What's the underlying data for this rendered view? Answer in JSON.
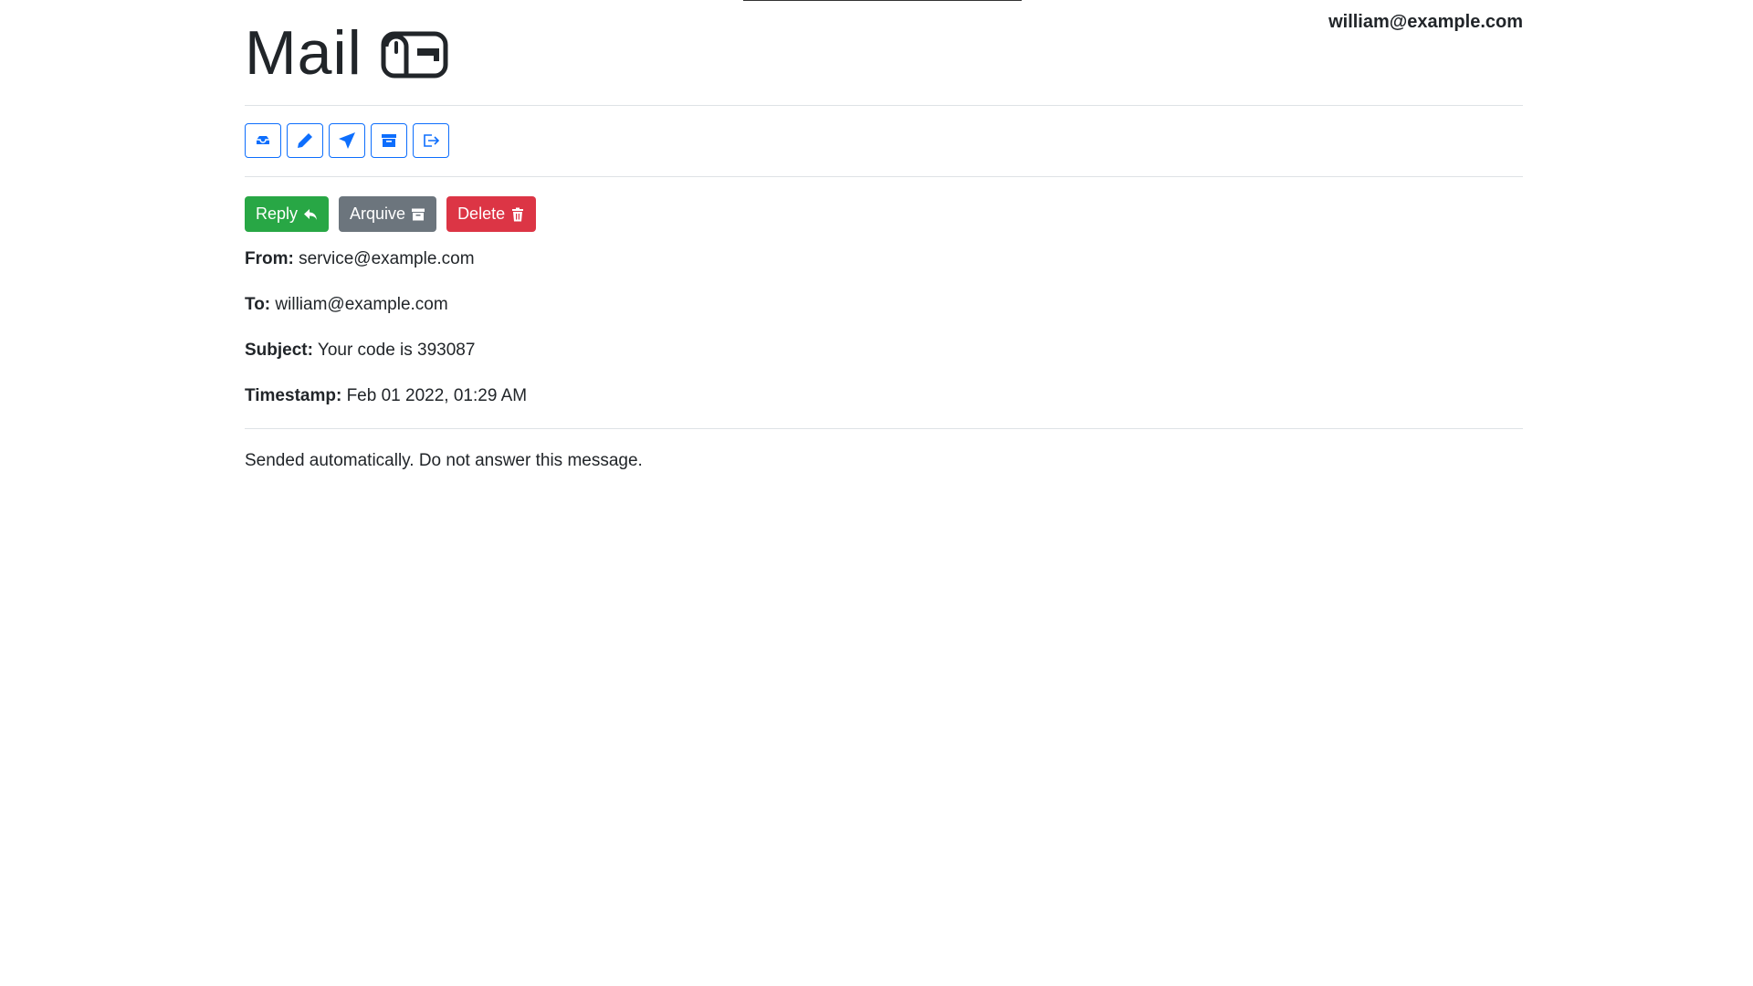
{
  "header": {
    "title": "Mail",
    "user_email": "william@example.com"
  },
  "nav_toolbar": [
    {
      "icon": "inbox-icon",
      "name": "inbox-button"
    },
    {
      "icon": "pencil-icon",
      "name": "compose-button"
    },
    {
      "icon": "send-icon",
      "name": "sent-button"
    },
    {
      "icon": "archive-icon",
      "name": "archive-folder-button"
    },
    {
      "icon": "logout-icon",
      "name": "logout-button"
    }
  ],
  "actions": {
    "reply_label": "Reply",
    "archive_label": "Arquive",
    "delete_label": "Delete"
  },
  "email": {
    "from_label": "From:",
    "from_value": "service@example.com",
    "to_label": "To:",
    "to_value": "william@example.com",
    "subject_label": "Subject:",
    "subject_value": "Your code is 393087",
    "timestamp_label": "Timestamp:",
    "timestamp_value": "Feb 01 2022, 01:29 AM",
    "body": "Sended automatically. Do not answer this message."
  },
  "colors": {
    "primary": "#0d6efd",
    "success": "#28a745",
    "secondary": "#6c757d",
    "danger": "#dc3545",
    "text": "#212529"
  }
}
